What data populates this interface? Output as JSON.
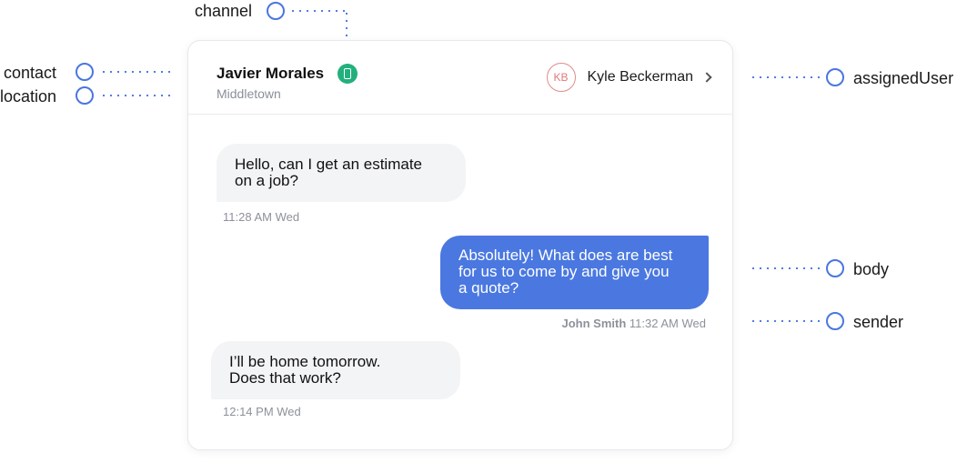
{
  "annotations": {
    "channel": "channel",
    "contact": "contact",
    "location": "location",
    "assignedUser": "assignedUser",
    "body": "body",
    "sender": "sender"
  },
  "colors": {
    "accent": "#4a76e0",
    "channel_badge": "#22b07d",
    "outgoing_bubble": "#4a78e0",
    "incoming_bubble": "#f3f4f6",
    "avatar_ring": "#e08a8a"
  },
  "conversation": {
    "contact_name": "Javier Morales",
    "location": "Middletown",
    "channel_icon": "mobile-phone-icon",
    "assigned_user": {
      "initials": "KB",
      "name": "Kyle Beckerman",
      "icon": "chevron-right-icon"
    },
    "messages": [
      {
        "direction": "incoming",
        "body": "Hello, can I get an estimate\non a job?",
        "time": "11:28 AM Wed"
      },
      {
        "direction": "outgoing",
        "body": "Absolutely! What does are best\nfor us to come by and give you\na quote?",
        "sender": "John Smith",
        "time": "11:32 AM Wed"
      },
      {
        "direction": "incoming",
        "body": "I’ll be home tomorrow.\nDoes that work?",
        "time": "12:14 PM Wed"
      }
    ]
  }
}
